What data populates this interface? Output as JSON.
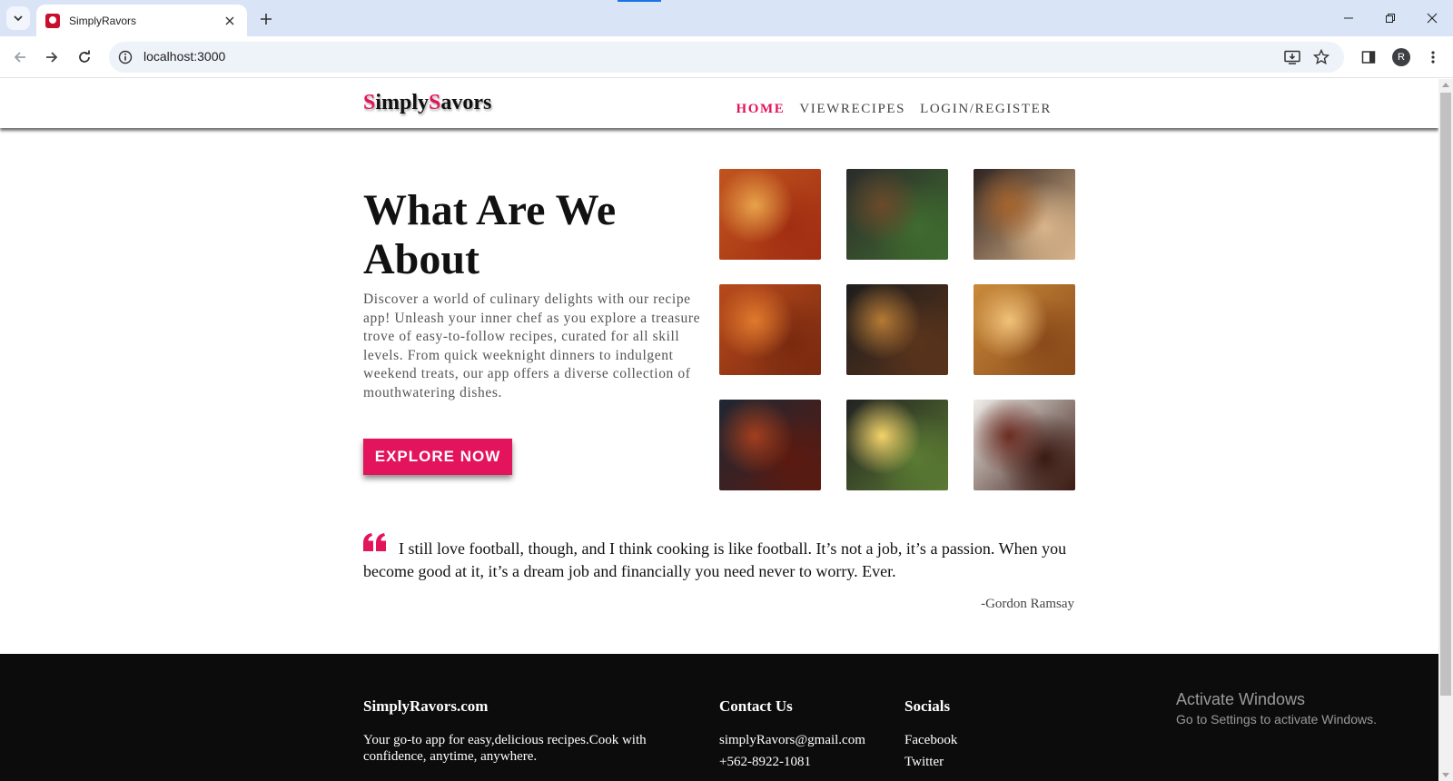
{
  "browser": {
    "tab_title": "SimplyRavors",
    "url": "localhost:3000",
    "profile_initial": "R"
  },
  "site": {
    "logo_first": "S",
    "logo_mid": "imply",
    "logo_second": "S",
    "logo_rest": "avors",
    "nav": [
      {
        "label": "HOME",
        "active": true
      },
      {
        "label": "VIEWRECIPES",
        "active": false
      },
      {
        "label": "LOGIN/REGISTER",
        "active": false
      }
    ],
    "accent_color": "#e3135c"
  },
  "hero": {
    "title": "What Are We About",
    "description": "Discover a world of culinary delights with our recipe app! Unleash your inner chef as you explore a treasure trove of easy-to-follow recipes, curated for all skill levels. From quick weeknight dinners to indulgent weekend treats, our app offers a diverse collection of mouthwatering dishes.",
    "button": "EXPLORE NOW"
  },
  "gallery": [
    {
      "name": "pizza-image",
      "colors": [
        "#c0541f",
        "#e8a34a",
        "#a22e12"
      ]
    },
    {
      "name": "rice-bowls-image",
      "colors": [
        "#2b2b2b",
        "#6b4a2b",
        "#3f6b2f"
      ]
    },
    {
      "name": "asian-dishes-image",
      "colors": [
        "#2e2320",
        "#a5642e",
        "#d9b48a"
      ]
    },
    {
      "name": "spaghetti-image",
      "colors": [
        "#b84a1c",
        "#e07a2d",
        "#7a2a10"
      ]
    },
    {
      "name": "burger-image",
      "colors": [
        "#1d1d1d",
        "#b57a35",
        "#5a341c"
      ]
    },
    {
      "name": "biryani-image",
      "colors": [
        "#c98a3a",
        "#f1c27a",
        "#8a4a1a"
      ]
    },
    {
      "name": "grilled-chicken-image",
      "colors": [
        "#1e2733",
        "#a23e1d",
        "#5b1a10"
      ]
    },
    {
      "name": "bibimbap-image",
      "colors": [
        "#222222",
        "#f4d36a",
        "#5b7b33"
      ]
    },
    {
      "name": "steak-image",
      "colors": [
        "#f0eeea",
        "#6b2c22",
        "#3a1a12"
      ]
    }
  ],
  "quote": {
    "text": "I still love football, though, and I think cooking is like football. It’s not a job, it’s a passion. When you become good at it, it’s a dream job and financially you need never to worry. Ever.",
    "author": "-Gordon Ramsay"
  },
  "footer": {
    "brand": "SimplyRavors.com",
    "tagline": "Your go-to app for easy,delicious recipes.Cook with confidence, anytime, anywhere.",
    "contact_heading": "Contact Us",
    "email": "simplyRavors@gmail.com",
    "phone": "+562-8922-1081",
    "socials_heading": "Socials",
    "socials": [
      "Facebook",
      "Twitter"
    ]
  },
  "watermark": {
    "line1": "Activate Windows",
    "line2": "Go to Settings to activate Windows."
  }
}
